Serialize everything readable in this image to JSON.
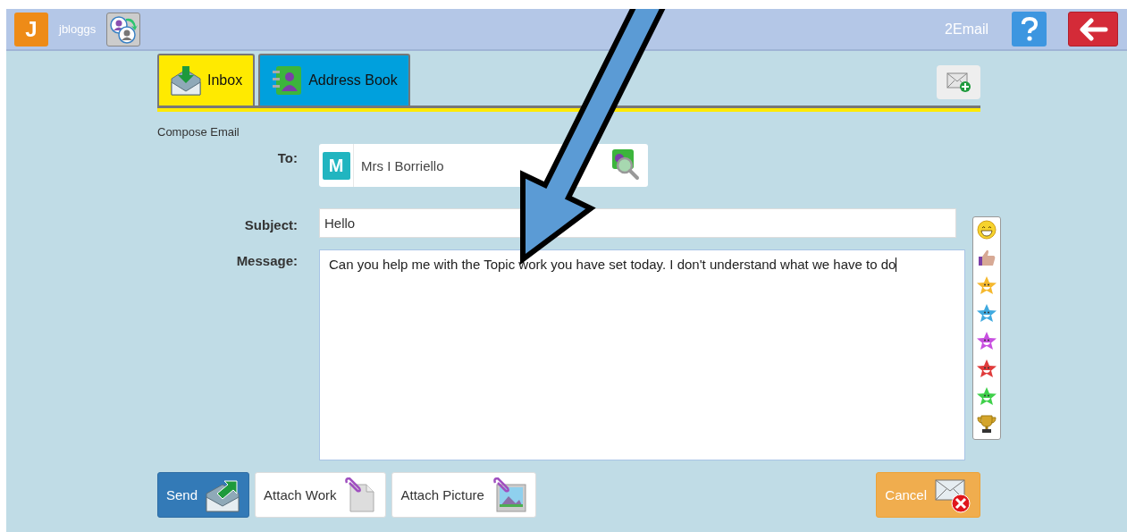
{
  "top_bar": {
    "avatar_letter": "J",
    "username": "jbloggs",
    "app_name": "2Email"
  },
  "tabs": [
    {
      "label": "Inbox",
      "selected": true
    },
    {
      "label": "Address Book",
      "selected": false
    }
  ],
  "compose": {
    "heading": "Compose Email",
    "to_label": "To:",
    "recipient_letter": "M",
    "recipient": "Mrs I Borriello",
    "subject_label": "Subject:",
    "subject": "Hello",
    "message_label": "Message:",
    "message": "Can you help me with the Topic work you have set today. I don't understand what we have to do"
  },
  "reactions": [
    {
      "kind": "smiley"
    },
    {
      "kind": "thumbs-up"
    },
    {
      "kind": "star",
      "color": "#f5b82e"
    },
    {
      "kind": "star",
      "color": "#3fa9df"
    },
    {
      "kind": "star",
      "color": "#c84fe0"
    },
    {
      "kind": "star",
      "color": "#e03b3b"
    },
    {
      "kind": "star",
      "color": "#3fd04a"
    },
    {
      "kind": "trophy"
    }
  ],
  "buttons": [
    {
      "label": "Send",
      "kind": "send"
    },
    {
      "label": "Attach Work",
      "kind": "attach-work"
    },
    {
      "label": "Attach Picture",
      "kind": "attach-picture"
    },
    {
      "label": "Cancel",
      "kind": "cancel"
    }
  ]
}
